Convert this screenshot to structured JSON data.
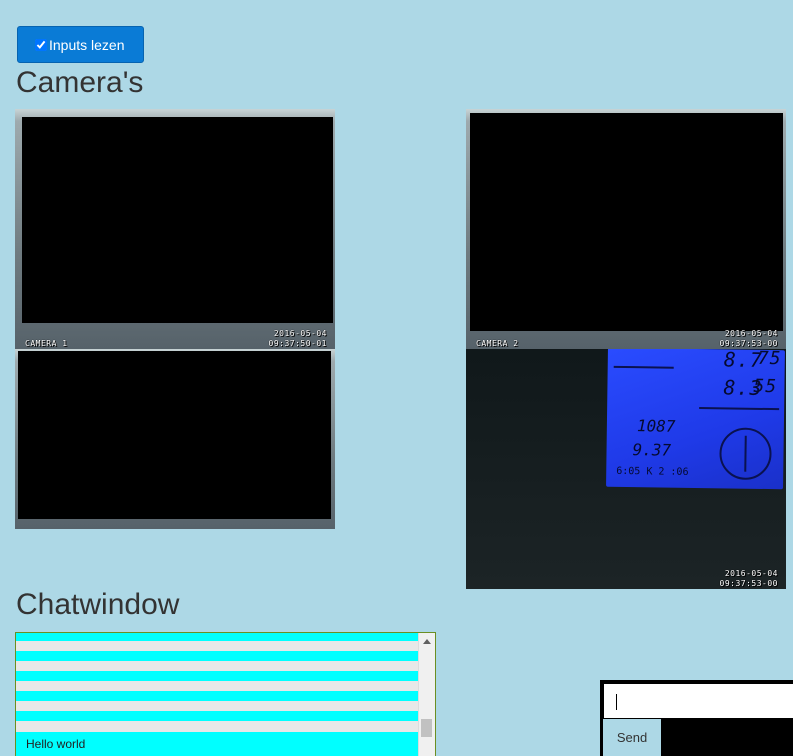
{
  "toolbar": {
    "inputs_label": "Inputs lezen",
    "inputs_checked": true
  },
  "sections": {
    "cameras_title": "Camera's",
    "chat_title": "Chatwindow"
  },
  "cameras": [
    {
      "label": "CAMERA 1",
      "date": "2016-05-04",
      "time": "09:37:50-01"
    },
    {
      "label": "CAMERA 2",
      "date": "2016-05-04",
      "time": "09:37:53-00"
    },
    {
      "label": "",
      "date": "",
      "time": ""
    },
    {
      "label": "",
      "date": "2016-05-04",
      "time": "09:37:53-00"
    }
  ],
  "weather_display": {
    "temp_top": "8.7",
    "temp_top2": "75",
    "temp_mid": "8.3",
    "temp_mid2": "55",
    "pressure": "1087",
    "value2": "9.37",
    "bottom": "6:05 K 2 :06"
  },
  "chat": {
    "messages": [
      "Hello world"
    ],
    "input_value": "",
    "send_label": "Send"
  },
  "colors": {
    "page_bg": "#add8e6",
    "button_bg": "#0a7bd6",
    "chat_highlight": "#00ffff"
  }
}
